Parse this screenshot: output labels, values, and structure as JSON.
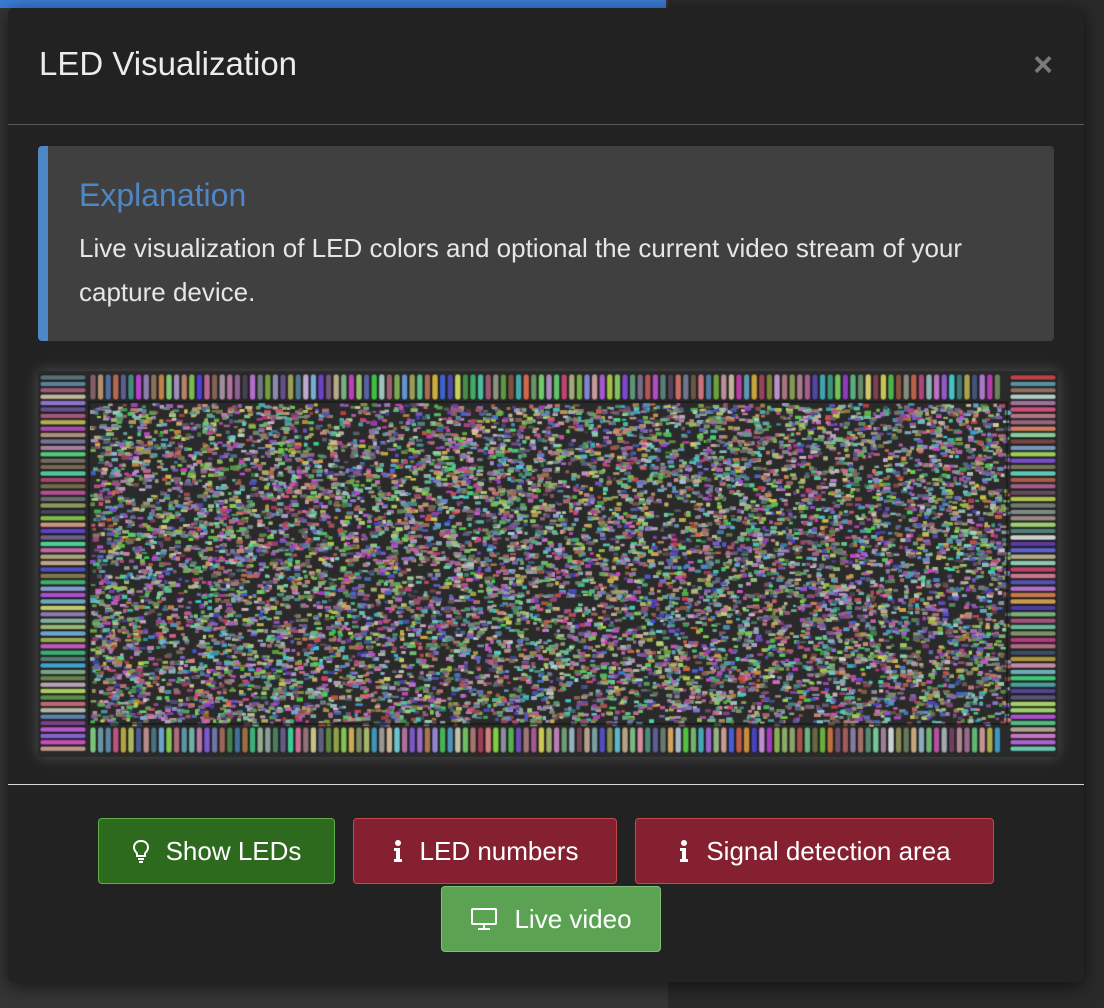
{
  "modal": {
    "title": "LED Visualization",
    "close_glyph": "×"
  },
  "explanation": {
    "title": "Explanation",
    "text": "Live visualization of LED colors and optional the current video stream of your capture device."
  },
  "buttons": {
    "show_leds": {
      "label": "Show LEDs",
      "icon": "lightbulb-icon"
    },
    "led_numbers": {
      "label": "LED numbers",
      "icon": "info-icon"
    },
    "signal_detection_area": {
      "label": "Signal detection area",
      "icon": "info-icon"
    },
    "live_video": {
      "label": "Live video",
      "icon": "monitor-icon"
    }
  },
  "colors": {
    "accent_blue": "#4f86c6",
    "success_dark": "#2d6a1e",
    "success_light": "#5ba353",
    "danger": "#84202f",
    "modal_bg": "#222222",
    "callout_bg": "#404040"
  }
}
